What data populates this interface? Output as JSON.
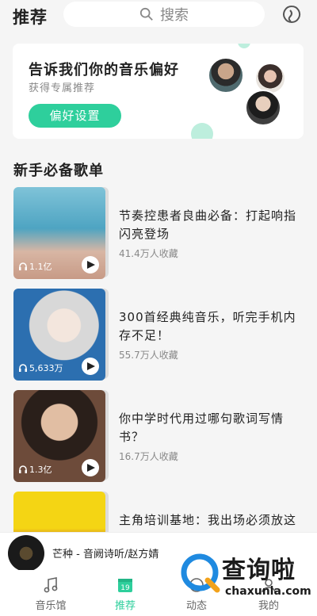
{
  "header": {
    "title": "推荐",
    "search_placeholder": "搜索"
  },
  "preference": {
    "heading": "告诉我们你的音乐偏好",
    "subtitle": "获得专属推荐",
    "button": "偏好设置"
  },
  "section": {
    "title": "新手必备歌单"
  },
  "playlists": [
    {
      "title": "节奏控患者良曲必备：打起响指闪亮登场",
      "plays": "1.1亿",
      "favorites": "41.4万人收藏"
    },
    {
      "title": "300首经典纯音乐，听完手机内存不足！",
      "plays": "5,633万",
      "favorites": "55.7万人收藏"
    },
    {
      "title": "你中学时代用过哪句歌词写情书？",
      "plays": "1.3亿",
      "favorites": "16.7万人收藏"
    },
    {
      "title": "主角培训基地：我出场必须放这些歌！",
      "plays": "",
      "favorites": ""
    }
  ],
  "player": {
    "song": "芒种 - 音阙诗听/赵方婧"
  },
  "nav": {
    "tabs": [
      "音乐馆",
      "推荐",
      "动态",
      "我的"
    ],
    "calendar_day": "19",
    "active": "推荐"
  },
  "watermark": {
    "text_cn": "查询啦",
    "text_en": "chaxunla.com"
  },
  "colors": {
    "accent": "#2ecf9c",
    "background": "#f5f5f5"
  }
}
